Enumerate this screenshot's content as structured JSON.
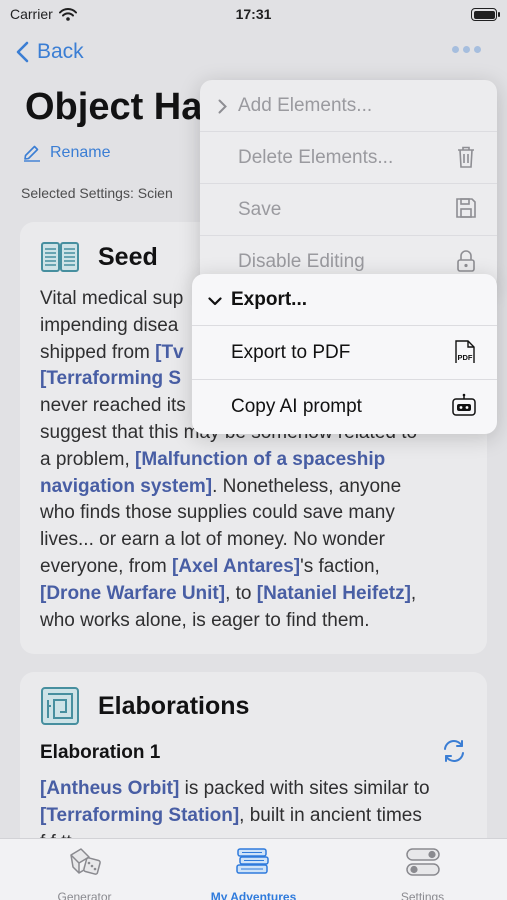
{
  "status_bar": {
    "carrier": "Carrier",
    "time": "17:31",
    "battery_level": 1.0
  },
  "nav": {
    "back_label": "Back",
    "more_icon": "ellipsis-icon"
  },
  "page": {
    "title": "Object Ha",
    "rename_label": "Rename",
    "selected_settings": "Selected Settings: Scien"
  },
  "seed": {
    "heading": "Seed",
    "icon": "book-icon",
    "lines": [
      [
        {
          "t": "Vital medical sup"
        }
      ],
      [
        {
          "t": "impending disea"
        }
      ],
      [
        {
          "t": "shipped from "
        },
        {
          "t": "[Tv",
          "link": true
        }
      ],
      [
        {
          "t": "[Terraforming S",
          "link": true
        }
      ],
      [
        {
          "t": "never reached its"
        }
      ],
      [
        {
          "t": "suggest that this may be somehow related to"
        }
      ],
      [
        {
          "t": "a problem, "
        },
        {
          "t": "[Malfunction of a spaceship",
          "link": true
        }
      ],
      [
        {
          "t": "navigation system]",
          "link": true
        },
        {
          "t": ". Nonetheless, anyone"
        }
      ],
      [
        {
          "t": "who finds those supplies could save many"
        }
      ],
      [
        {
          "t": "lives... or earn a lot of money. No wonder"
        }
      ],
      [
        {
          "t": "everyone, from "
        },
        {
          "t": "[Axel Antares]",
          "link": true
        },
        {
          "t": "'s faction,"
        }
      ],
      [
        {
          "t": "[Drone Warfare Unit]",
          "link": true
        },
        {
          "t": ", to "
        },
        {
          "t": "[Nataniel Heifetz]",
          "link": true
        },
        {
          "t": ","
        }
      ],
      [
        {
          "t": "who works alone, is eager to find them."
        }
      ]
    ]
  },
  "elaborations": {
    "heading": "Elaborations",
    "icon": "maze-icon",
    "item_title": "Elaboration 1",
    "lines": [
      [
        {
          "t": "[Antheus Orbit]",
          "link": true
        },
        {
          "t": " is packed with sites similar to"
        }
      ],
      [
        {
          "t": "[Terraforming Station]",
          "link": true
        },
        {
          "t": ", built in ancient times"
        }
      ],
      [
        {
          "t": "f                   f     tt"
        }
      ]
    ]
  },
  "menu_main": {
    "items": [
      {
        "label": "Add Elements...",
        "icon": "chevron-right-icon"
      },
      {
        "label": "Delete Elements...",
        "icon": "trash-icon"
      },
      {
        "label": "Save",
        "icon": "save-icon"
      },
      {
        "label": "Disable Editing",
        "icon": "lock-icon"
      }
    ]
  },
  "menu_export": {
    "items": [
      {
        "label": "Export...",
        "icon": "chevron-down-icon"
      },
      {
        "label": "Export to PDF",
        "icon": "pdf-icon",
        "icon_text": "PDF"
      },
      {
        "label": "Copy AI prompt",
        "icon": "robot-icon"
      }
    ]
  },
  "tabs": [
    {
      "label": "Generator",
      "icon": "dice-icon",
      "active": false
    },
    {
      "label": "My Adventures",
      "icon": "books-icon",
      "active": true
    },
    {
      "label": "Settings",
      "icon": "toggles-icon",
      "active": false
    }
  ],
  "colors": {
    "accent": "#2f7bdc",
    "link": "#3e57a6",
    "icon_teal": "#3d8fa0"
  }
}
